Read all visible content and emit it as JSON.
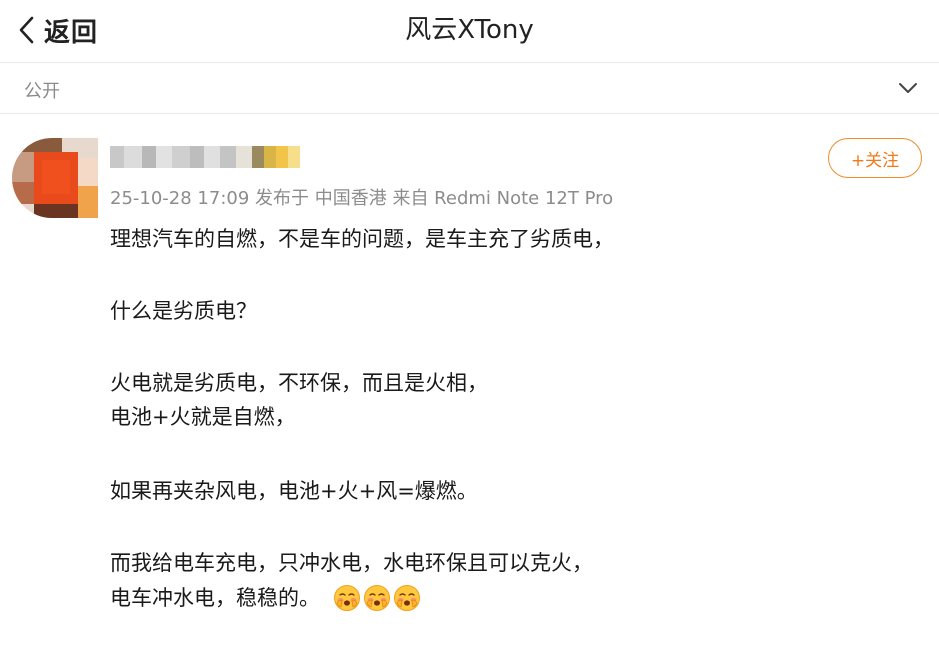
{
  "nav": {
    "back_label": "返回",
    "title": "风云XTony"
  },
  "visibility": {
    "label": "公开"
  },
  "post": {
    "author": {
      "name": "",
      "avatar": "pixelated-avatar"
    },
    "meta": "25-10-28 17:09  发布于 中国香港  来自 Redmi Note 12T Pro",
    "follow_label": "+关注",
    "lines": [
      "理想汽车的自燃，不是车的问题，是车主充了劣质电，",
      "什么是劣质电？",
      "火电就是劣质电，不环保，而且是火相，",
      "电池+火就是自燃，",
      "如果再夹杂风电，电池+火+风=爆燃。",
      "而我给电车充电，只冲水电，水电环保且可以克火，",
      "电车冲水电，稳稳的。"
    ],
    "emojis": [
      "face-blush-icon",
      "face-blush-icon",
      "face-blush-icon"
    ]
  },
  "colors": {
    "accent": "#f07a1a",
    "meta_text": "#8c8c8c",
    "divider": "#ececec"
  }
}
